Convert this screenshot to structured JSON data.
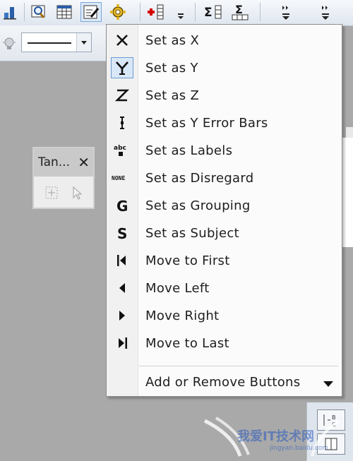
{
  "toolbar": {
    "buttons": [
      {
        "icon": "chart-icon"
      },
      {
        "icon": "magnify-icon"
      },
      {
        "icon": "worksheet-icon"
      },
      {
        "icon": "edit-notes-icon"
      },
      {
        "icon": "gear-icon"
      },
      {
        "icon": "add-column-icon"
      },
      {
        "icon": "column-stats-icon"
      },
      {
        "icon": "row-stats-icon"
      }
    ]
  },
  "floating_toolbar": {
    "title": "Tan...",
    "close_label": "✕"
  },
  "menu": {
    "items": [
      {
        "label": "Set as X",
        "glyph": "X"
      },
      {
        "label": "Set as Y",
        "glyph": "Y"
      },
      {
        "label": "Set as Z",
        "glyph": "Z"
      },
      {
        "label": "Set as Y Error Bars",
        "glyph": "I"
      },
      {
        "label": "Set as Labels",
        "glyph": "abc"
      },
      {
        "label": "Set as Disregard",
        "glyph": "NONE"
      },
      {
        "label": "Set as Grouping",
        "glyph": "G"
      },
      {
        "label": "Set as Subject",
        "glyph": "S"
      },
      {
        "label": "Move to First",
        "glyph": ""
      },
      {
        "label": "Move Left",
        "glyph": ""
      },
      {
        "label": "Move Right",
        "glyph": ""
      },
      {
        "label": "Move to Last",
        "glyph": ""
      }
    ],
    "footer_label": "Add or Remove Buttons"
  },
  "watermark": {
    "main": "我爱IT技术网",
    "sub": "jingyan.baidu.com"
  },
  "colors": {
    "accent": "#6d9bd1",
    "workspace": "#a9a9a9"
  }
}
